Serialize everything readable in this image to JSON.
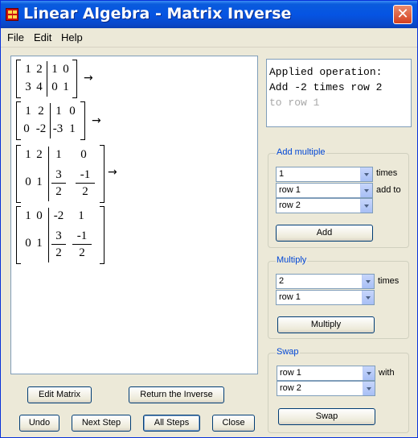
{
  "window": {
    "title": "Linear Algebra - Matrix Inverse",
    "close_glyph": "✕"
  },
  "menu": [
    "File",
    "Edit",
    "Help"
  ],
  "matrices": [
    {
      "rows": [
        [
          "1",
          "2",
          "1",
          "0"
        ],
        [
          "3",
          "4",
          "0",
          "1"
        ]
      ],
      "arrow": "→"
    },
    {
      "rows": [
        [
          "1",
          "2",
          "1",
          "0"
        ],
        [
          "0",
          "-2",
          "-3",
          "1"
        ]
      ],
      "arrow": "→"
    },
    {
      "rows": [
        [
          "1",
          "2",
          "1",
          "0"
        ],
        [
          "0",
          "1",
          "3/2",
          "-1/2"
        ]
      ],
      "arrow": "→"
    },
    {
      "rows": [
        [
          "1",
          "0",
          "-2",
          "1"
        ],
        [
          "0",
          "1",
          "3/2",
          "-1/2"
        ]
      ]
    }
  ],
  "operation": {
    "line1": "Applied operation:",
    "line2": "Add -2 times row 2",
    "line3": "to row 1"
  },
  "add_multiple": {
    "label": "Add multiple",
    "multiplier": "1",
    "times_label": "times",
    "source_row": "row 1",
    "add_to_label": "add to",
    "target_row": "row 2",
    "button": "Add"
  },
  "multiply": {
    "label": "Multiply",
    "value": "2",
    "times_label": "times",
    "row": "row 1",
    "button": "Multiply"
  },
  "swap": {
    "label": "Swap",
    "row_a": "row 1",
    "with_label": "with",
    "row_b": "row 2",
    "button": "Swap"
  },
  "buttons": {
    "edit_matrix": "Edit Matrix",
    "return_inverse": "Return the Inverse",
    "undo": "Undo",
    "next_step": "Next Step",
    "all_steps": "All Steps",
    "close": "Close"
  }
}
